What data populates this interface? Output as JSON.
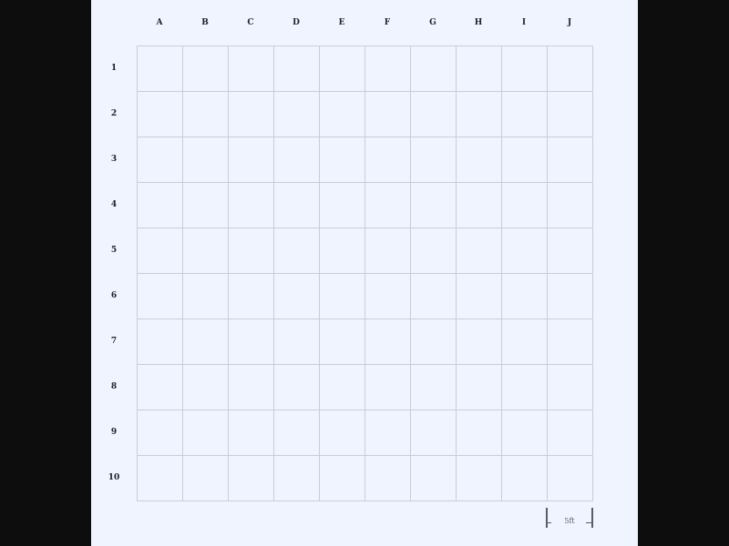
{
  "board": {
    "columns": [
      "A",
      "B",
      "C",
      "D",
      "E",
      "F",
      "G",
      "H",
      "I",
      "J"
    ],
    "rows": [
      "1",
      "2",
      "3",
      "4",
      "5",
      "6",
      "7",
      "8",
      "9",
      "10"
    ],
    "scale_label": "5ft",
    "colors": {
      "background": "#f0f4fe",
      "gridline": "#c9cdd8",
      "label": "#1f1f28",
      "letterbox": "#0d0d0d"
    }
  }
}
